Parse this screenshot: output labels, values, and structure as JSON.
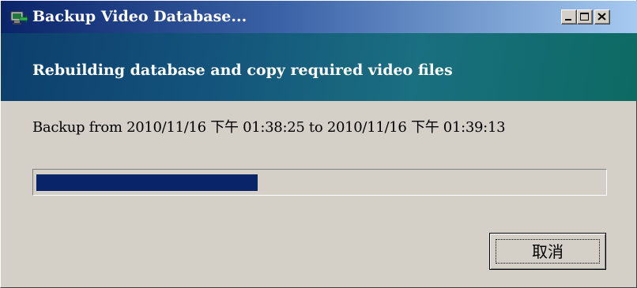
{
  "window": {
    "title": "Backup Video Database...",
    "icon": "backup-app-icon",
    "controls": {
      "minimize": "minimize-icon",
      "maximize": "maximize-icon",
      "close": "close-icon"
    },
    "colors": {
      "titlebar_start": "#0a246a",
      "titlebar_end": "#a6caf0",
      "banner_start": "#0c3e6c",
      "banner_end": "#0c6a62",
      "face": "#d4d0c8",
      "progress_fill": "#0a246a"
    }
  },
  "banner": {
    "heading": "Rebuilding database and copy required video files"
  },
  "status": {
    "backup_range": "Backup from 2010/11/16 下午 01:38:25 to 2010/11/16 下午 01:39:13"
  },
  "progress": {
    "fraction": 0.39
  },
  "buttons": {
    "cancel_label": "取消"
  }
}
